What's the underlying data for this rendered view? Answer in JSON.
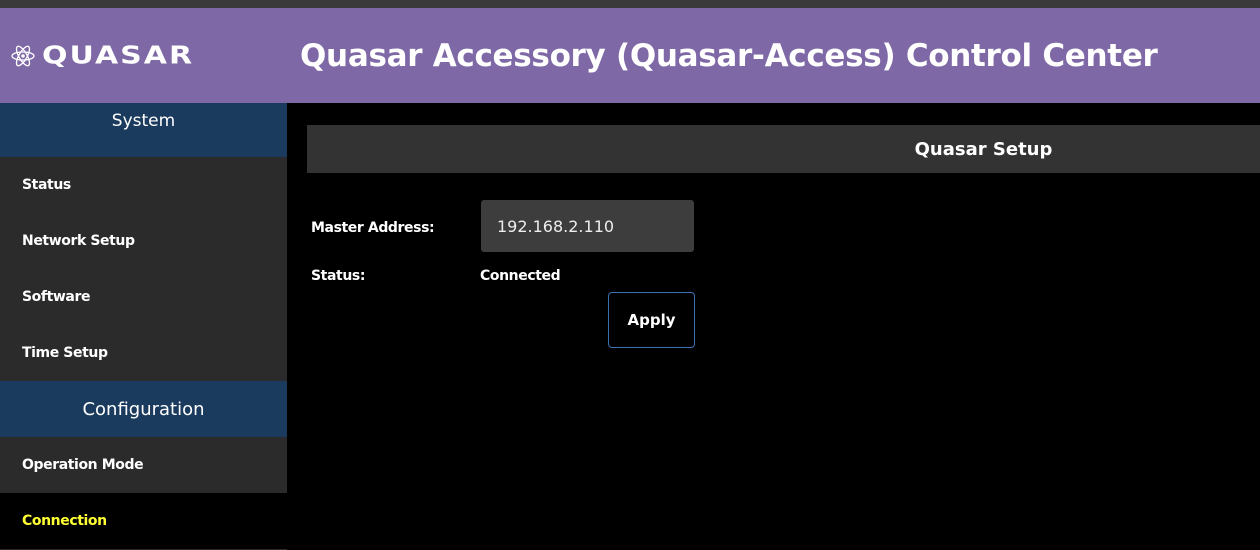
{
  "header": {
    "logo_text": "QUASAR",
    "logo_icon": "atom-icon",
    "title": "Quasar Accessory (Quasar-Access) Control Center"
  },
  "sidebar": {
    "system_heading": "System",
    "system_items": [
      {
        "label": "Status"
      },
      {
        "label": "Network Setup"
      },
      {
        "label": "Software"
      },
      {
        "label": "Time Setup"
      }
    ],
    "configuration_heading": "Configuration",
    "configuration_items": [
      {
        "label": "Operation Mode"
      },
      {
        "label": "Connection"
      }
    ]
  },
  "main": {
    "panel_title": "Quasar Setup",
    "master_address_label": "Master Address:",
    "master_address_value": "192.168.2.110",
    "status_label": "Status:",
    "status_value": "Connected",
    "apply_label": "Apply"
  },
  "colors": {
    "header_bg": "#7e68a6",
    "section_bg": "#1b3b5e",
    "active_link": "#ffff33"
  }
}
